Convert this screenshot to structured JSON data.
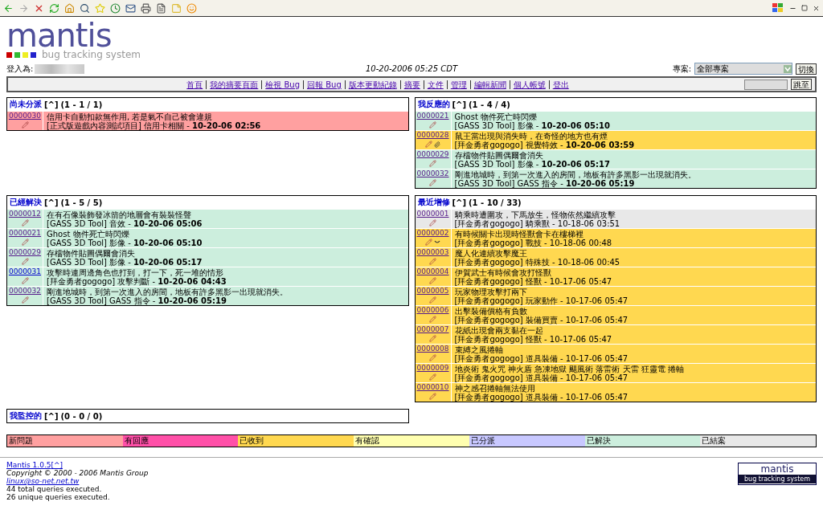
{
  "header": {
    "logo": "mantis",
    "tagline": "bug tracking system",
    "login_label": "登入為:",
    "datetime": "10-20-2006 05:25 CDT",
    "project_label": "專案:",
    "project_value": "全部專案",
    "switch_button": "切換"
  },
  "nav": {
    "links": [
      "首頁",
      "我的摘要頁面",
      "檢視 Bug",
      "回報 Bug",
      "版本更動紀錄",
      "摘要",
      "文件",
      "管理",
      "編輯新聞",
      "個人帳號",
      "登出"
    ],
    "jump_button": "跳至"
  },
  "panels": [
    {
      "title": "尚未分派",
      "top_link": "[^]",
      "count": "(1 - 1 / 1)",
      "rows": [
        {
          "id": "0000030",
          "visited": true,
          "color": "#ffa0a0",
          "summary": "信用卡自動扣款無作用, 若是氣不自己被會違規",
          "detail": "[正式版遊戲內容測試項目] 信用卡相關 - **10-20-06 02:56**"
        }
      ]
    },
    {
      "title": "我反應的",
      "top_link": "[^]",
      "count": "(1 - 4 / 4)",
      "rows": [
        {
          "id": "0000021",
          "visited": true,
          "color": "#cceedd",
          "summary": "Ghost 物件死亡時閃爍",
          "detail": "[GASS 3D Tool] 影像 - **10-20-06 05:10**"
        },
        {
          "id": "0000028",
          "visited": true,
          "color": "#ffd850",
          "summary": "鼠王當出現與消失時，在奇怪的地方也有煙",
          "detail": "[拜金勇者gogogo] 視覺特效 - **10-20-06 03:59**",
          "kind": "attachment"
        },
        {
          "id": "0000029",
          "visited": true,
          "color": "#cceedd",
          "summary": "存檔物件貼圖偶爾會消失",
          "detail": "[GASS 3D Tool] 影像 - **10-20-06 05:17**"
        },
        {
          "id": "0000032",
          "visited": true,
          "color": "#cceedd",
          "summary": "剛進地城時，到第一次進入的房間，地板有許多黑影一出現就消失。",
          "detail": "[GASS 3D Tool] GASS 指令 - **10-20-06 05:19**"
        }
      ]
    },
    {
      "title": "已經解決",
      "top_link": "[^]",
      "count": "(1 - 5 / 5)",
      "rows": [
        {
          "id": "0000012",
          "visited": true,
          "color": "#cceedd",
          "summary": "在有石像裝飾發冰箭的地層會有裝裝怪聲",
          "detail": "[GASS 3D Tool] 音效 - **10-20-06 05:06**"
        },
        {
          "id": "0000021",
          "visited": true,
          "color": "#cceedd",
          "summary": "Ghost 物件死亡時閃爍",
          "detail": "[GASS 3D Tool] 影像 - **10-20-06 05:10**"
        },
        {
          "id": "0000029",
          "visited": true,
          "color": "#cceedd",
          "summary": "存檔物件貼圖偶爾會消失",
          "detail": "[GASS 3D Tool] 影像 - **10-20-06 05:17**"
        },
        {
          "id": "0000031",
          "visited": false,
          "color": "#cceedd",
          "summary": "攻擊時連周邊角色也打到，打一下，死一堆的情形",
          "detail": "[拜金勇者gogogo] 攻擊判斷 - **10-20-06 04:43**"
        },
        {
          "id": "0000032",
          "visited": true,
          "color": "#cceedd",
          "summary": "剛進地城時，到第一次進入的房間，地板有許多黑影一出現就消失。",
          "detail": "[GASS 3D Tool] GASS 指令 - **10-20-06 05:19**"
        }
      ]
    },
    {
      "title": "最近增修",
      "top_link": "[^]",
      "count": "(1 - 10 / 33)",
      "rows": [
        {
          "id": "0000001",
          "visited": true,
          "color": "#e8e8e8",
          "summary": "騎乘時遭圍攻，下馬放生，怪物依然繼續攻擊",
          "detail": "[拜金勇者gogogo] 騎乘獸 - 10-18-06 03:51"
        },
        {
          "id": "0000002",
          "visited": true,
          "color": "#ffd850",
          "summary": "有時候關卡出現時怪獸會卡在樓梯裡",
          "detail": "[拜金勇者gogogo] 戰技 - 10-18-06 00:48",
          "kind": "note"
        },
        {
          "id": "0000003",
          "visited": true,
          "color": "#ffd850",
          "summary": "魔人化連續攻擊魔王",
          "detail": "[拜金勇者gogogo] 特殊技 - 10-18-06 00:45"
        },
        {
          "id": "0000004",
          "visited": true,
          "color": "#ffd850",
          "summary": "伊賀武士有時候會攻打怪獸",
          "detail": "[拜金勇者gogogo] 怪獸 - 10-17-06 05:47"
        },
        {
          "id": "0000005",
          "visited": true,
          "color": "#ffd850",
          "summary": "玩家物理攻擊打兩下",
          "detail": "[拜金勇者gogogo] 玩家動作 - 10-17-06 05:47"
        },
        {
          "id": "0000006",
          "visited": true,
          "color": "#ffd850",
          "summary": "出擊裝備價格有負數",
          "detail": "[拜金勇者gogogo] 裝備買賣 - 10-17-06 05:47"
        },
        {
          "id": "0000007",
          "visited": true,
          "color": "#ffd850",
          "summary": "花紙出現會兩支黏在一起",
          "detail": "[拜金勇者gogogo] 怪獸 - 10-17-06 05:47"
        },
        {
          "id": "0000008",
          "visited": true,
          "color": "#ffd850",
          "summary": "束縛之風捲軸",
          "detail": "[拜金勇者gogogo] 道具裝備 - 10-17-06 05:47"
        },
        {
          "id": "0000009",
          "visited": true,
          "color": "#ffd850",
          "summary": "地炎術 鬼火咒 神火盾 急凍地獄 颶風術 落雷術 天雷 狂靈電 捲軸",
          "detail": "[拜金勇者gogogo] 道具裝備 - 10-17-06 05:47"
        },
        {
          "id": "0000010",
          "visited": true,
          "color": "#ffd850",
          "summary": "神之感召捲軸無法使用",
          "detail": "[拜金勇者gogogo] 道具裝備 - 10-17-06 05:47"
        }
      ]
    },
    {
      "title": "我監控的",
      "top_link": "[^]",
      "count": "(0 - 0 / 0)"
    }
  ],
  "legend": [
    {
      "label": "新問題",
      "color": "#ffa0a0"
    },
    {
      "label": "有回應",
      "color": "#ff50a8"
    },
    {
      "label": "已收到",
      "color": "#ffd850"
    },
    {
      "label": "有確認",
      "color": "#ffffb0"
    },
    {
      "label": "已分派",
      "color": "#c8c8ff"
    },
    {
      "label": "已解決",
      "color": "#cceedd"
    },
    {
      "label": "已結案",
      "color": "#e8e8e8"
    }
  ],
  "footer": {
    "version": "Mantis 1.0.5",
    "top_link": "[^]",
    "copyright": "Copyright © 2000 - 2006 Mantis Group",
    "email": "linux@so-net.net.tw",
    "queries": [
      "44 total queries executed.",
      "26 unique queries executed."
    ],
    "logo": "mantis",
    "tagline": "bug tracking system"
  }
}
